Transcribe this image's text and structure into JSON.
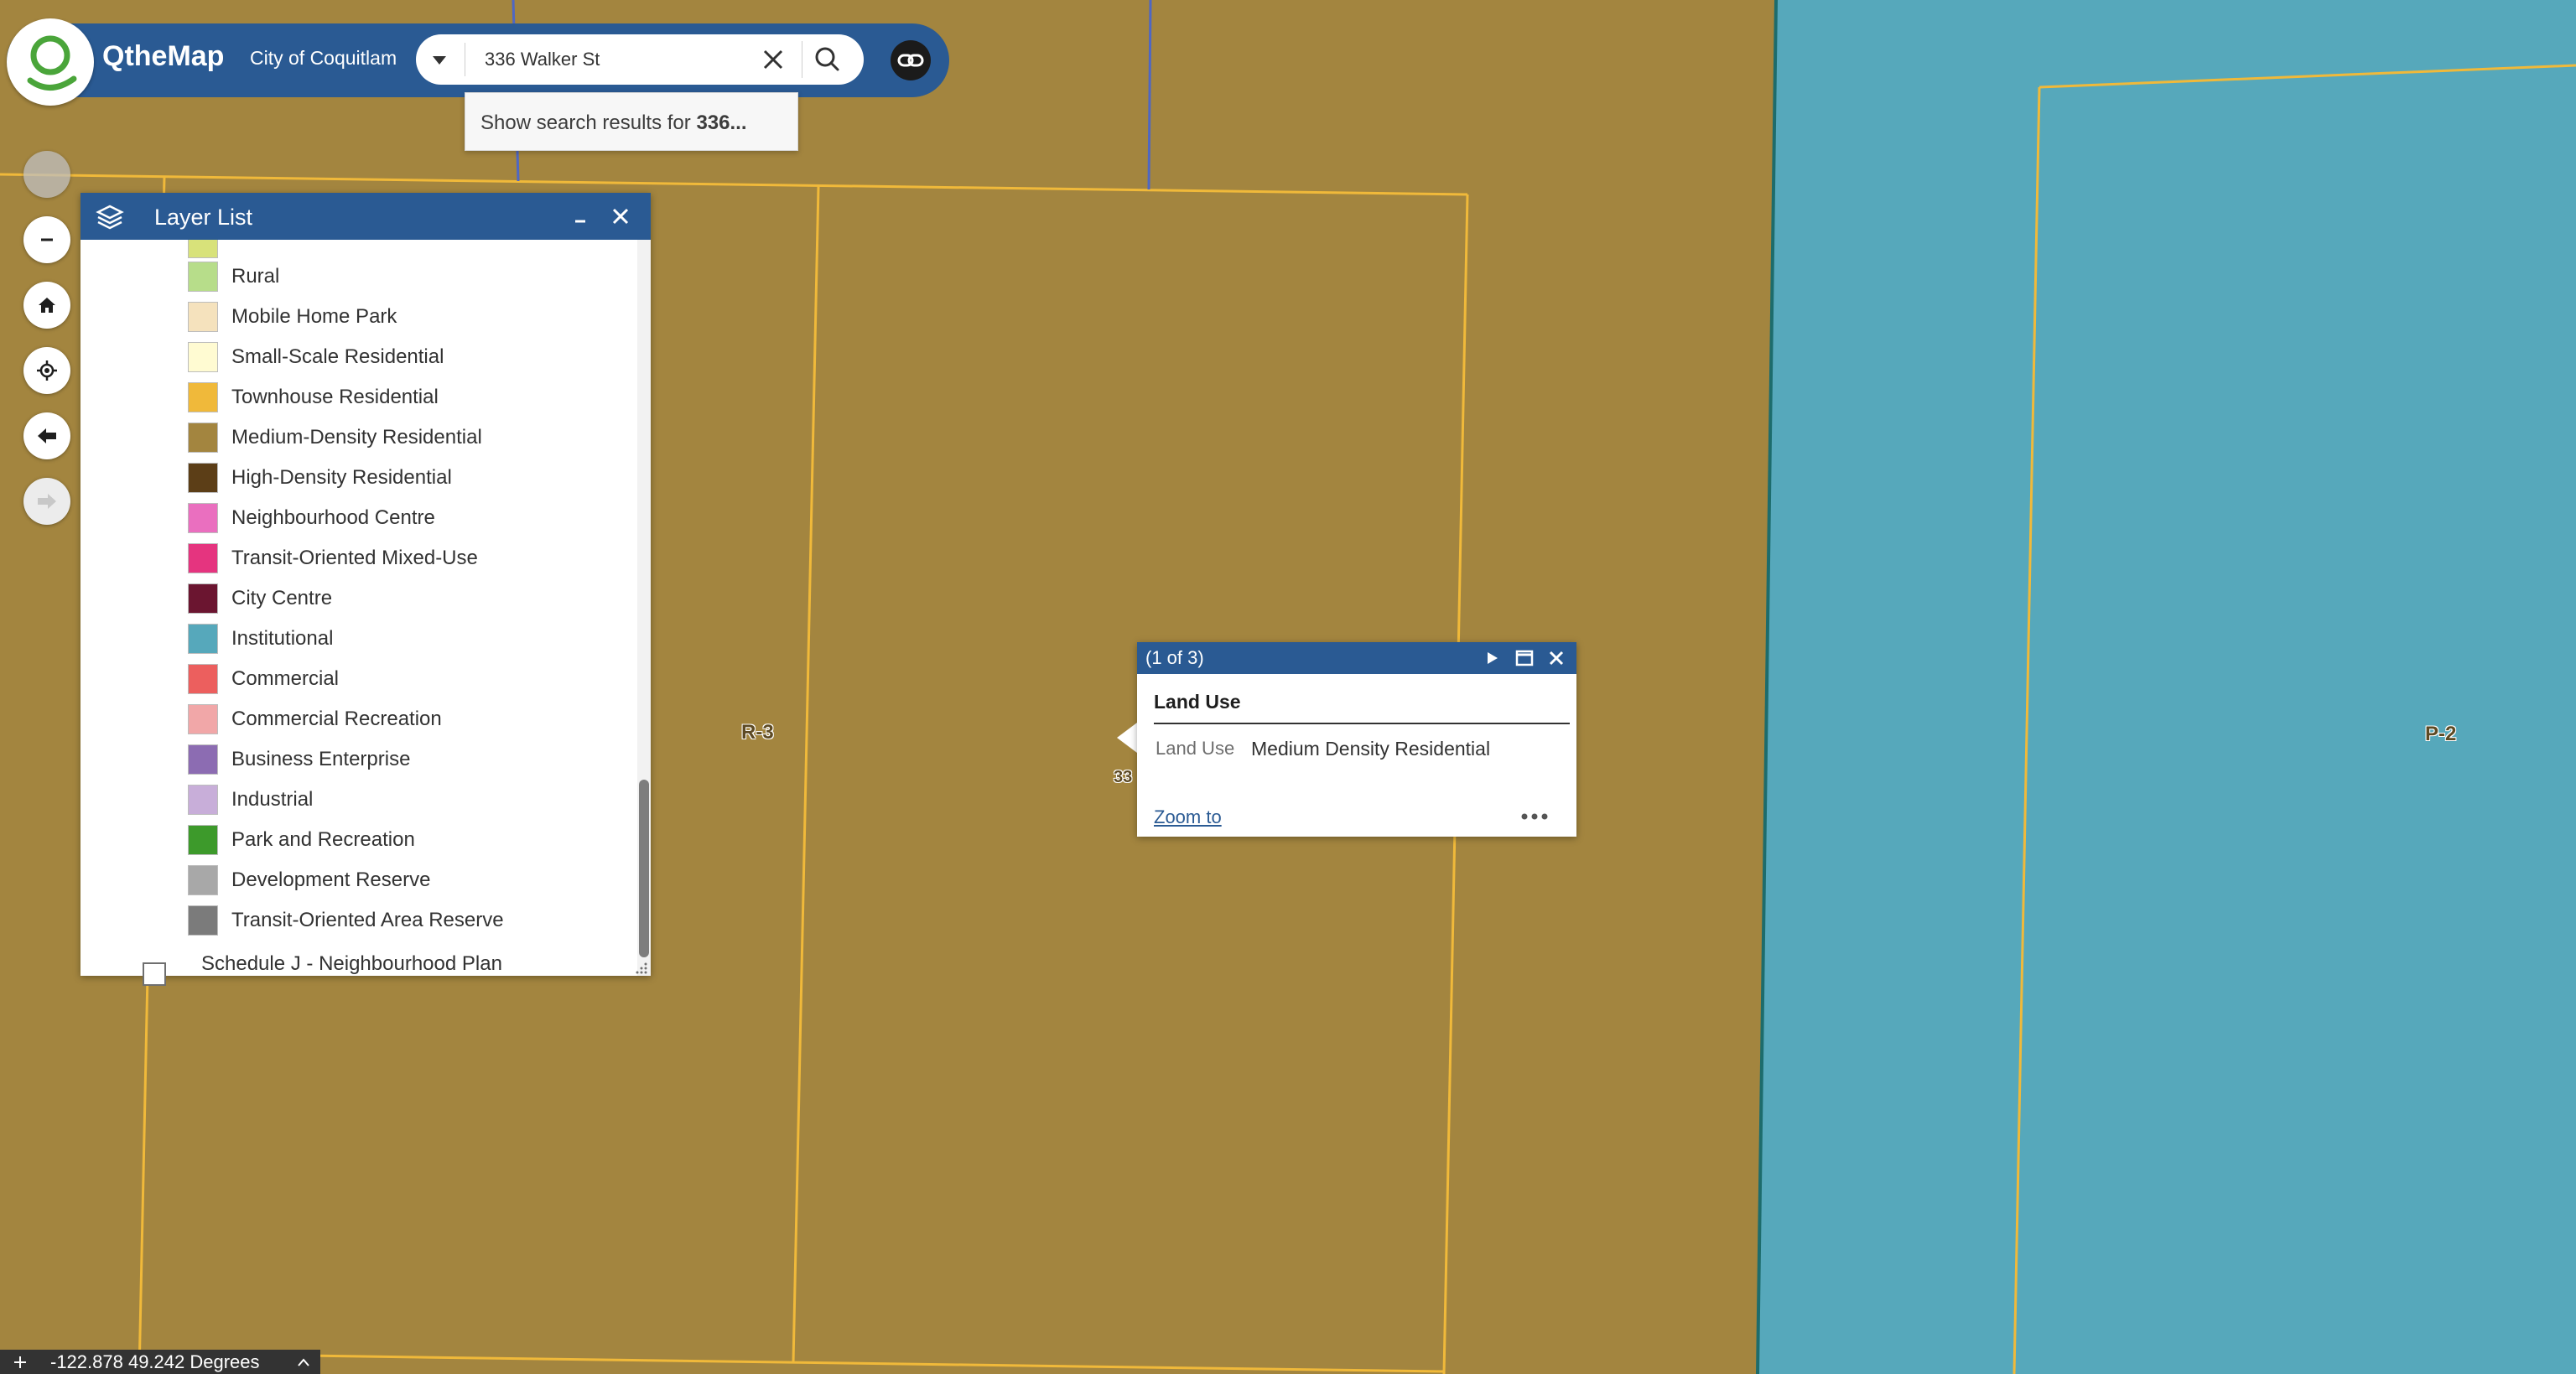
{
  "header": {
    "app_title": "QtheMap",
    "subtitle": "City of Coquitlam"
  },
  "search": {
    "value": "336 Walker St",
    "suggestion_prefix": "Show search results for ",
    "suggestion_term": "336..."
  },
  "navigation": {
    "buttons": [
      "zoom-in",
      "zoom-out",
      "home",
      "locate",
      "previous-extent",
      "next-extent"
    ]
  },
  "layer_list": {
    "title": "Layer List",
    "items": [
      {
        "label": "Rural",
        "color": "#b7dd8a"
      },
      {
        "label": "Mobile Home Park",
        "color": "#f5e2bd"
      },
      {
        "label": "Small-Scale Residential",
        "color": "#fffbd2"
      },
      {
        "label": "Townhouse Residential",
        "color": "#f0b93a"
      },
      {
        "label": "Medium-Density Residential",
        "color": "#a3853f"
      },
      {
        "label": "High-Density Residential",
        "color": "#5c3e17"
      },
      {
        "label": "Neighbourhood Centre",
        "color": "#ea6fbf"
      },
      {
        "label": "Transit-Oriented Mixed-Use",
        "color": "#e5347f"
      },
      {
        "label": "City Centre",
        "color": "#6b1530"
      },
      {
        "label": "Institutional",
        "color": "#56a8bb"
      },
      {
        "label": "Commercial",
        "color": "#ec5f5e"
      },
      {
        "label": "Commercial Recreation",
        "color": "#f1a7a8"
      },
      {
        "label": "Business Enterprise",
        "color": "#8c6cb2"
      },
      {
        "label": "Industrial",
        "color": "#c8aed9"
      },
      {
        "label": "Park and Recreation",
        "color": "#3d9a2b"
      },
      {
        "label": "Development Reserve",
        "color": "#a8a8a8"
      },
      {
        "label": "Transit-Oriented Area Reserve",
        "color": "#7b7b7b"
      }
    ],
    "next_group": "Schedule J - Neighbourhood Plan"
  },
  "popup": {
    "count": "(1 of 3)",
    "title": "Land Use",
    "field_name": "Land Use",
    "field_value": "Medium Density Residential",
    "zoom_link": "Zoom to"
  },
  "map_labels": {
    "zone_left": "R-3",
    "zone_right": "P-2",
    "parcel_partial": "33"
  },
  "coordinates": "-122.878 49.242 Degrees",
  "colors": {
    "medium_density": "#a3853f",
    "institutional": "#56a8bb",
    "parcel_line": "#f0b93a",
    "brand_blue": "#2a5a93"
  }
}
